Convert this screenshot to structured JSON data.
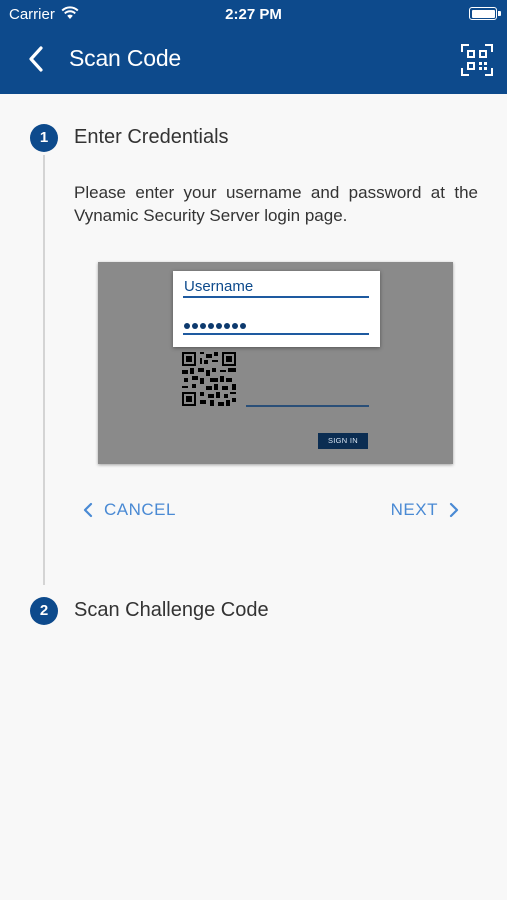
{
  "status_bar": {
    "carrier": "Carrier",
    "time": "2:27 PM"
  },
  "nav": {
    "title": "Scan Code",
    "back_icon": "chevron-left-icon",
    "right_icon": "qr-code-scan-icon"
  },
  "steps": [
    {
      "number": "1",
      "title": "Enter Credentials",
      "instruction": "Please enter your username and password at the Vynamic Security Server login page.",
      "illustration": {
        "username_label": "Username",
        "sign_in_label": "SIGN IN"
      },
      "actions": {
        "cancel_label": "CANCEL",
        "next_label": "NEXT"
      }
    },
    {
      "number": "2",
      "title": "Scan Challenge Code"
    }
  ],
  "colors": {
    "header": "#0d4a8c",
    "accent": "#4a8ad4",
    "background": "#f8f8f8"
  }
}
